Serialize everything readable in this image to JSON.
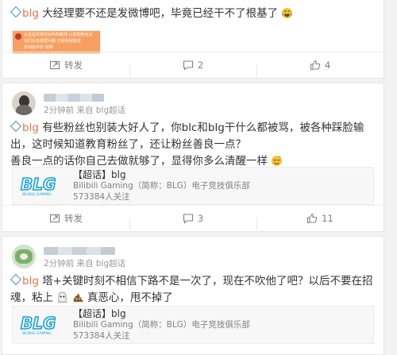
{
  "posts": [
    {
      "text_tag": "blg",
      "text": "大经理要不还是发微博吧，毕竟已经干不了根基了",
      "embedded_image_lines": [
        "以及在年终时对外的新闻 以前的粉丝对",
        "他们队伍哪里问题 已经有回复说",
        "反响的不好 说明"
      ],
      "actions": {
        "repost": "转发",
        "comments": "2",
        "likes": "4"
      }
    },
    {
      "author": "",
      "meta": "2分钟前 来自 blg超话",
      "text_tag": "blg",
      "text": "有些粉丝也别装大好人了，你blc和blg干什么都被骂，被各种踩脸输出，这时候知道教育粉丝了，还让粉丝善良一点？",
      "text2": "善良一点的话你自己去做就够了，显得你多么清醒一样",
      "topic": {
        "logo_text": "BLG",
        "logo_sub": "BILIBILI GAMING",
        "name": "【超话】blg",
        "desc": "Bilibili Gaming（简称：BLG）电子竞技俱乐部",
        "followers": "573384人关注"
      },
      "actions": {
        "repost": "转发",
        "comments": "3",
        "likes": "11"
      }
    },
    {
      "author": "",
      "meta": "2分钟前 来自 blg超话",
      "text_tag": "blg",
      "text": "塔+关键时刻不相信下路不是一次了，现在不吹他了吧？以后不要在招魂，粘上",
      "text_tail": "真恶心，甩不掉了",
      "topic": {
        "logo_text": "BLG",
        "logo_sub": "BILIBILI GAMING",
        "name": "【超话】blg",
        "desc": "Bilibili Gaming（简称：BLG）电子竞技俱乐部",
        "followers": "573384人关注"
      }
    }
  ],
  "colors": {
    "tag": "#eb7350",
    "logo": "#1ba3d6",
    "icon": "#808080"
  },
  "icons": [
    "diamond-icon",
    "repost-icon",
    "comment-icon",
    "like-icon",
    "emoji-icon"
  ]
}
